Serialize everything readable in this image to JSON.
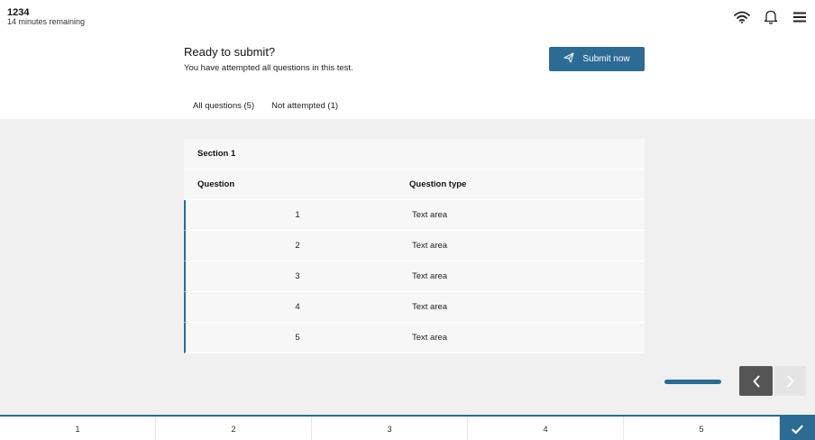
{
  "header": {
    "candidate_id": "1234",
    "time_remaining": "14 minutes remaining",
    "icons": [
      "wifi-icon",
      "bell-icon",
      "menu-icon"
    ]
  },
  "submit_panel": {
    "title": "Ready to submit?",
    "message": "You have attempted all questions in this test.",
    "button_label": "Submit now",
    "button_icon": "send-icon"
  },
  "tabs": [
    {
      "label": "All questions (5)"
    },
    {
      "label": "Not attempted (1)"
    }
  ],
  "table": {
    "section_title": "Section 1",
    "columns": [
      "Question",
      "Question type"
    ],
    "rows": [
      {
        "number": "1",
        "type": "Text area"
      },
      {
        "number": "2",
        "type": "Text area"
      },
      {
        "number": "3",
        "type": "Text area"
      },
      {
        "number": "4",
        "type": "Text area"
      },
      {
        "number": "5",
        "type": "Text area"
      }
    ]
  },
  "bottom_nav": {
    "items": [
      "1",
      "2",
      "3",
      "4",
      "5"
    ],
    "check_icon": "check-icon"
  },
  "colors": {
    "accent": "#2c6b93",
    "background": "#f0f0f0"
  }
}
